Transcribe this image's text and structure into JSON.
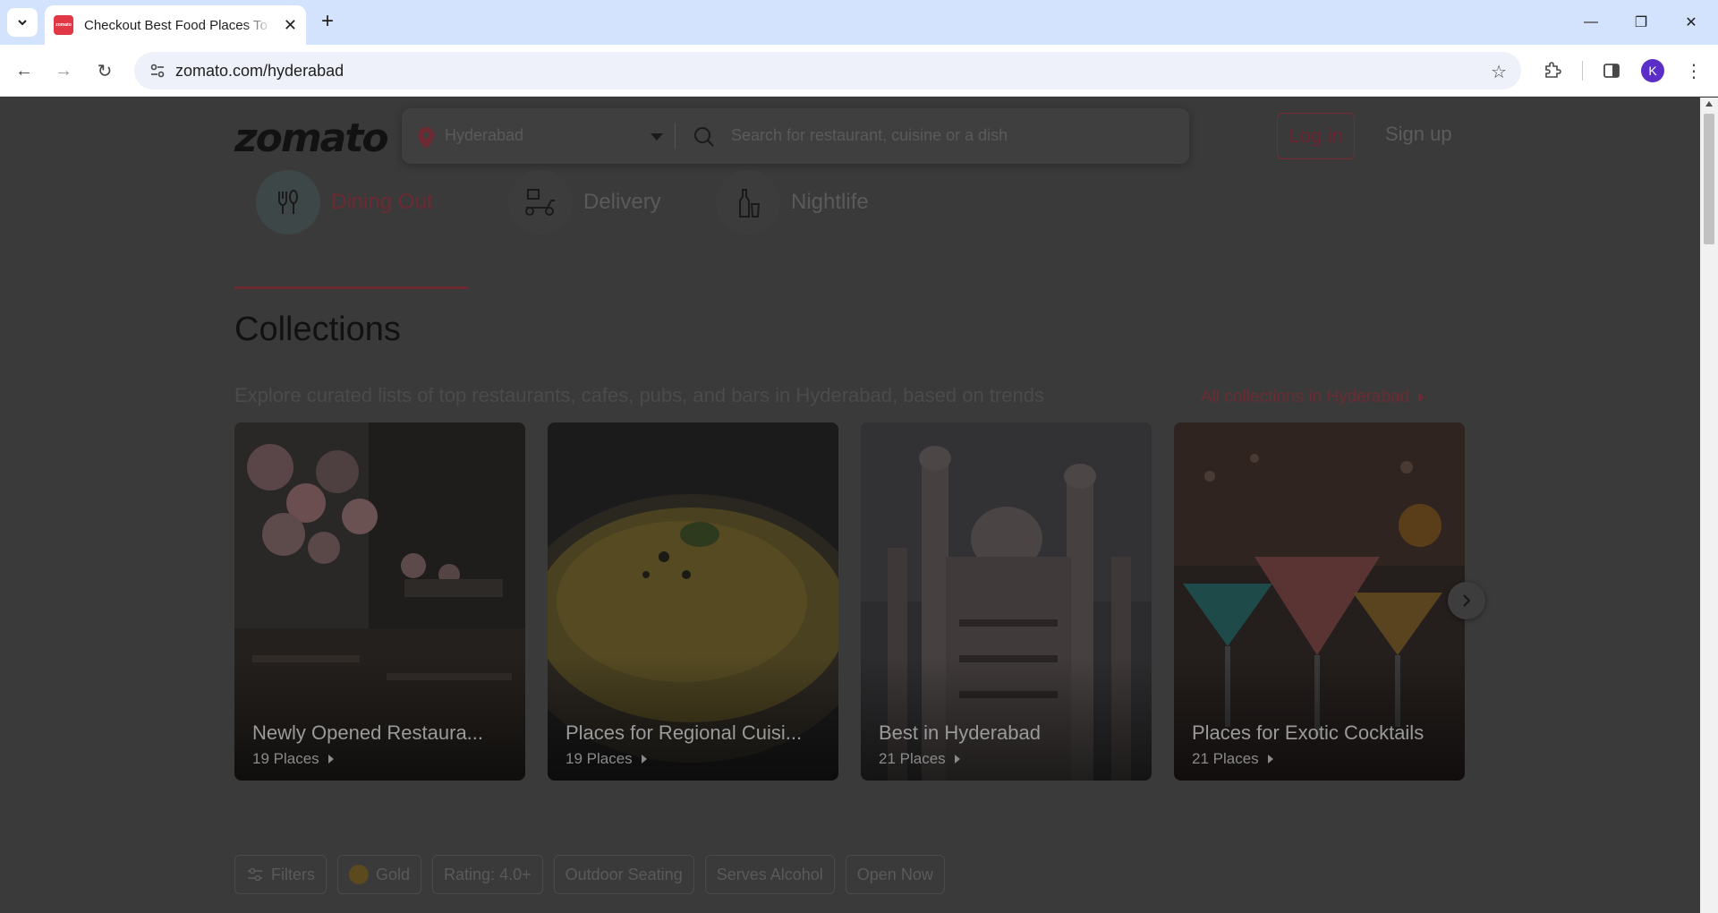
{
  "browser": {
    "tab_title": "Checkout Best Food Places To Eat in Hyderabad",
    "favicon_text": "zomato",
    "url": "zomato.com/hyderabad",
    "profile_initial": "K"
  },
  "header": {
    "logo": "zomato",
    "location": "Hyderabad",
    "search_placeholder": "Search for restaurant, cuisine or a dish",
    "login": "Log in",
    "signup": "Sign up"
  },
  "modes": [
    {
      "label": "Dining Out",
      "active": true,
      "icon": "dining-icon"
    },
    {
      "label": "Delivery",
      "active": false,
      "icon": "delivery-scooter-icon"
    },
    {
      "label": "Nightlife",
      "active": false,
      "icon": "nightlife-bottle-icon"
    }
  ],
  "collections": {
    "heading": "Collections",
    "subtitle": "Explore curated lists of top restaurants, cafes, pubs, and bars in Hyderabad, based on trends",
    "all_link": "All collections in Hyderabad",
    "cards": [
      {
        "title": "Newly Opened Restaura...",
        "count": "19 Places"
      },
      {
        "title": "Places for Regional Cuisi...",
        "count": "19 Places"
      },
      {
        "title": "Best in Hyderabad",
        "count": "21 Places"
      },
      {
        "title": "Places for Exotic Cocktails",
        "count": "21 Places"
      }
    ]
  },
  "filters": [
    "Filters",
    "Gold",
    "Rating: 4.0+",
    "Outdoor Seating",
    "Serves Alcohol",
    "Open Now"
  ],
  "colors": {
    "brand_red": "#e23744",
    "overlay_bg": "#3a3a3a",
    "chrome_tabbar": "#d3e3fd",
    "profile_purple": "#5b2fc7"
  }
}
